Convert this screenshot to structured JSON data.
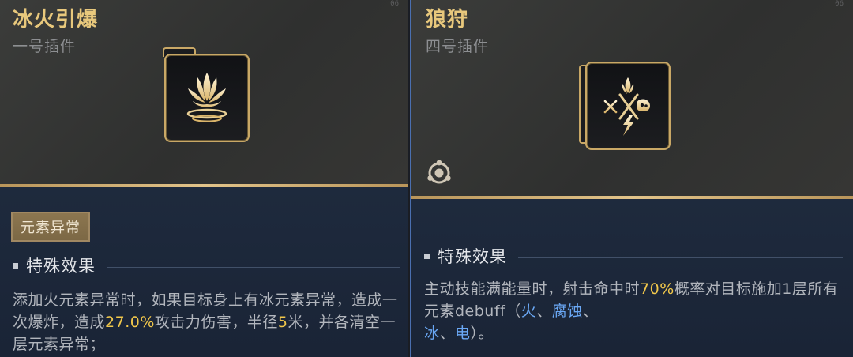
{
  "left_card": {
    "title": "冰火引爆",
    "subtitle": "一号插件",
    "corner_text": "06",
    "tag": "元素异常",
    "section_title": "特殊效果",
    "description": {
      "p1": "添加火元素异常时，如果目标身上有冰元素异常，造成一次爆炸，造成",
      "v1": "27.0%",
      "p2": "攻击力伤害，半径",
      "v2": "5",
      "p3": "米，并各清空一层元素异常；"
    },
    "icon": "fire-flower-plugin-icon"
  },
  "right_card": {
    "title": "狼狩",
    "subtitle": "四号插件",
    "corner_text": "06",
    "section_title": "特殊效果",
    "description": {
      "p1": "主动技能满能量时，射击命中时",
      "v1": "70%",
      "p2": "概率对目标施加1层所有元素debuff（",
      "e1": "火",
      "s1": "、",
      "e2": "腐蚀",
      "s2": "、",
      "e3": "冰",
      "s3": "、",
      "e4": "电",
      "p3": "）。"
    },
    "icon": "elements-cross-plugin-icon",
    "faction_icon": "triangle-ring-icon"
  },
  "colors": {
    "gold": "#e8c87c",
    "highlight_gold": "#f2c84b",
    "highlight_blue": "#6aa8f5",
    "divider_blue": "#4a6fb0"
  }
}
